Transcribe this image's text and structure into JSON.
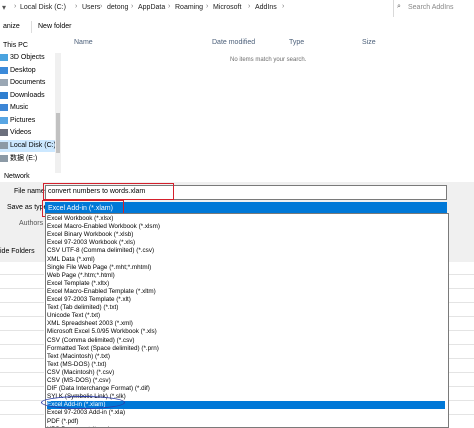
{
  "address_bar": {
    "crumbs": [
      "Local Disk (C:)",
      "Users",
      "detong",
      "AppData",
      "Roaming",
      "Microsoft",
      "AddIns"
    ],
    "search_placeholder": "Search AddIns"
  },
  "toolbar": {
    "organize_label": "anize",
    "new_folder_label": "New folder"
  },
  "nav": {
    "items": [
      "This PC",
      "3D Objects",
      "Desktop",
      "Documents",
      "Downloads",
      "Music",
      "Pictures",
      "Videos",
      "Local Disk (C:)",
      "数据 (E:)",
      "Network"
    ]
  },
  "list": {
    "columns": [
      "Name",
      "Date modified",
      "Type",
      "Size"
    ],
    "empty_message": "No items match your search."
  },
  "form": {
    "file_name_label": "File name:",
    "file_name_value": "convert numbers to words.xlam",
    "save_as_type_label": "Save as type:",
    "save_as_type_value": "Excel Add-in (*.xlam)",
    "authors_label": "Authors",
    "hide_folders_label": "ide Folders"
  },
  "save_types": [
    "Excel Workbook (*.xlsx)",
    "Excel Macro-Enabled Workbook (*.xlsm)",
    "Excel Binary Workbook (*.xlsb)",
    "Excel 97-2003 Workbook (*.xls)",
    "CSV UTF-8 (Comma delimited) (*.csv)",
    "XML Data (*.xml)",
    "Single File Web Page (*.mht;*.mhtml)",
    "Web Page (*.htm;*.html)",
    "Excel Template (*.xltx)",
    "Excel Macro-Enabled Template (*.xltm)",
    "Excel 97-2003 Template (*.xlt)",
    "Text (Tab delimited) (*.txt)",
    "Unicode Text (*.txt)",
    "XML Spreadsheet 2003 (*.xml)",
    "Microsoft Excel 5.0/95 Workbook (*.xls)",
    "CSV (Comma delimited) (*.csv)",
    "Formatted Text (Space delimited) (*.prn)",
    "Text (Macintosh) (*.txt)",
    "Text (MS-DOS) (*.txt)",
    "CSV (Macintosh) (*.csv)",
    "CSV (MS-DOS) (*.csv)",
    "DIF (Data Interchange Format) (*.dif)",
    "SYLK (Symbolic Link) (*.slk)",
    "Excel Add-in (*.xlam)",
    "Excel 97-2003 Add-in (*.xla)",
    "PDF (*.pdf)",
    "XPS Document (*.xps)"
  ],
  "highlighted_index": 23,
  "colors": {
    "selection": "#0078d7",
    "annotation_red": "#d4202c",
    "annotation_blue": "#2c3ea8"
  }
}
